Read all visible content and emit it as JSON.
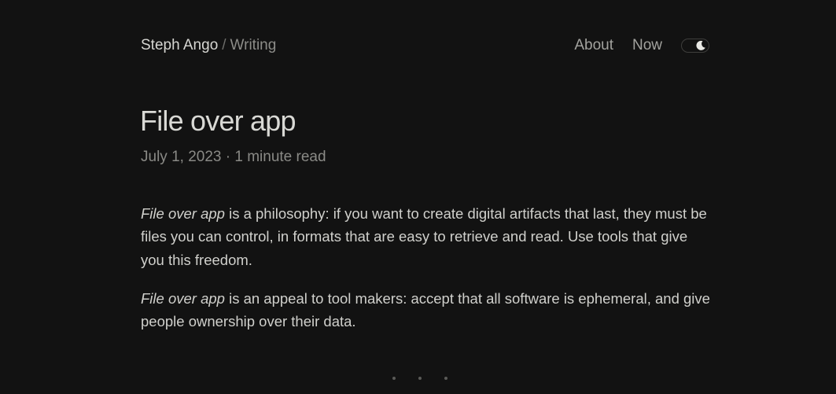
{
  "header": {
    "site_name": "Steph Ango",
    "separator": "/",
    "section": "Writing",
    "nav": [
      {
        "label": "About"
      },
      {
        "label": "Now"
      }
    ],
    "theme_toggle_icon": "moon-icon"
  },
  "article": {
    "title": "File over app",
    "date": "July 1, 2023",
    "meta_separator": "·",
    "read_time": "1 minute read",
    "paragraphs": [
      {
        "emphasis": "File over app",
        "text": " is a philosophy: if you want to create digital artifacts that last, they must be files you can control, in formats that are easy to retrieve and read. Use tools that give you this freedom."
      },
      {
        "emphasis": "File over app",
        "text": " is an appeal to tool makers: accept that all software is ephemeral, and give people ownership over their data."
      }
    ]
  },
  "colors": {
    "background": "#121212",
    "text": "#d6d6d2",
    "muted": "#8a8a86"
  }
}
